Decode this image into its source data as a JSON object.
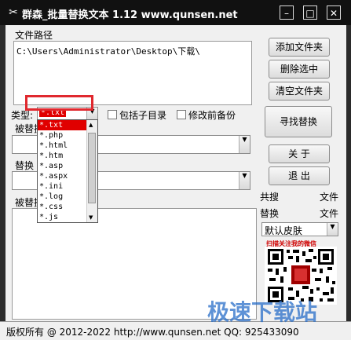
{
  "window": {
    "title": "群森_批量替换文本  1.12    www.qunsen.net",
    "minimize_glyph": "–",
    "restore_glyph": "□",
    "close_glyph": "✕"
  },
  "path": {
    "label": "文件路径",
    "value": "C:\\Users\\Administrator\\Desktop\\下载\\"
  },
  "buttons": {
    "add_folder": "添加文件夹",
    "delete_selected": "删除选中",
    "clear_folders": "清空文件夹",
    "find_replace": "寻找替换",
    "about": "关  于",
    "exit": "退  出"
  },
  "filter": {
    "type_label": "类型:",
    "selected": "*.txt",
    "options": [
      "*.txt",
      "*.php",
      "*.html",
      "*.htm",
      "*.asp",
      "*.aspx",
      "*.ini",
      "*.log",
      "*.css",
      "*.js"
    ],
    "include_subdirs_label": "包括子目录",
    "backup_label": "修改前备份"
  },
  "fields": {
    "replaced_label_partial": "被替换",
    "replace_label_partial": "替换",
    "replaced_text_label_partial": "被替换"
  },
  "sidebar": {
    "share_search": "共搜",
    "share_file": "文件",
    "replace": "替换",
    "replace_file": "文件",
    "skin_select": "默认皮肤",
    "qr_caption": "扫描关注我的微信"
  },
  "statusbar": {
    "text": "版权所有 @ 2012-2022   http://www.qunsen.net   QQ: 925433090"
  },
  "watermark": {
    "text": "极速下载站"
  },
  "colors": {
    "titlebar": "#111111",
    "selection": "#e00000",
    "highlight_frame": "#e0282e"
  }
}
